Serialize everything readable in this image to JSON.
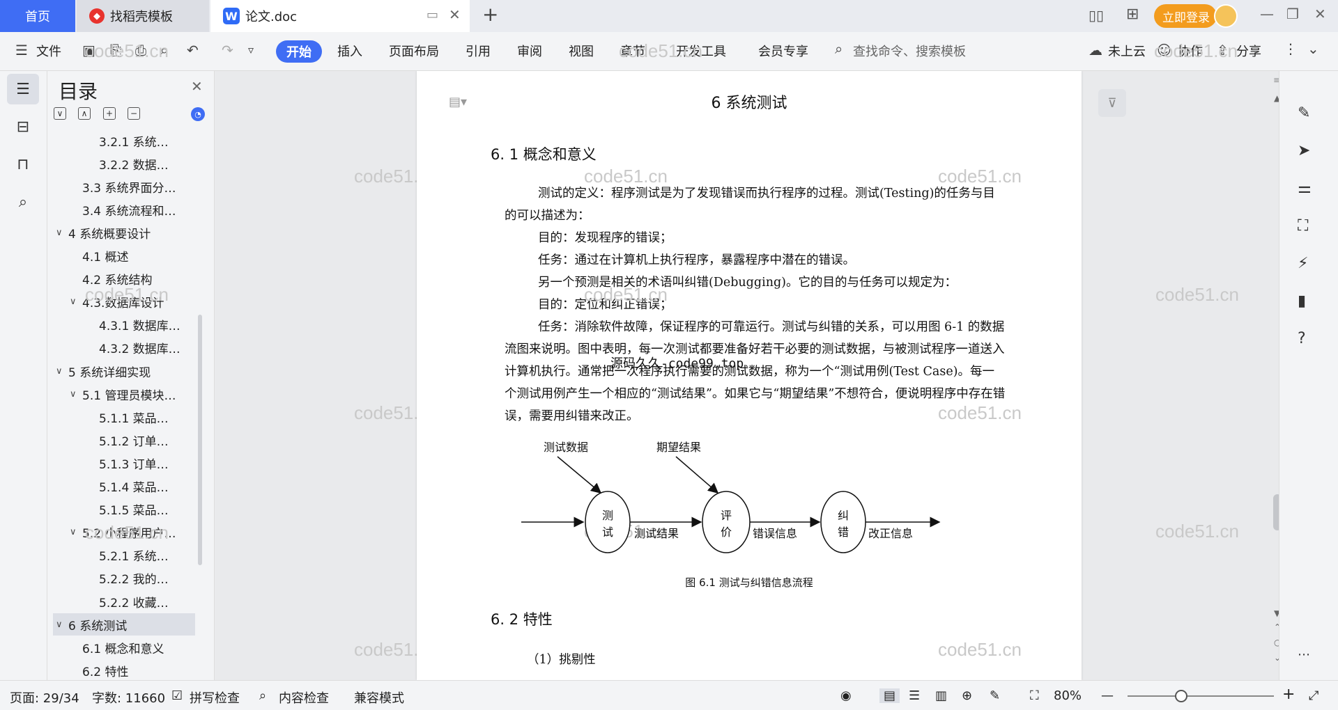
{
  "tabs": {
    "home": "首页",
    "daoke": "找稻壳模板",
    "doc": "论文.doc",
    "new_tab": "+"
  },
  "header": {
    "login": "立即登录"
  },
  "ribbon": {
    "file": "文件",
    "start": "开始",
    "insert": "插入",
    "layout": "页面布局",
    "reference": "引用",
    "review": "审阅",
    "view": "视图",
    "chapter": "章节",
    "devtools": "开发工具",
    "member": "会员专享",
    "search": "查找命令、搜索模板",
    "cloud": "未上云",
    "collab": "协作",
    "share": "分享"
  },
  "toc": {
    "title": "目录",
    "items": [
      {
        "label": "3.2.1 系统…",
        "level": 3
      },
      {
        "label": "3.2.2 数据…",
        "level": 3
      },
      {
        "label": "3.3 系统界面分…",
        "level": 2
      },
      {
        "label": "3.4 系统流程和…",
        "level": 2
      },
      {
        "label": "4 系统概要设计",
        "level": 1,
        "caret": "∨"
      },
      {
        "label": "4.1 概述",
        "level": 2
      },
      {
        "label": "4.2 系统结构",
        "level": 2
      },
      {
        "label": "4.3.数据库设计",
        "level": 2,
        "caret": "∨"
      },
      {
        "label": "4.3.1 数据库…",
        "level": 3
      },
      {
        "label": "4.3.2 数据库…",
        "level": 3
      },
      {
        "label": "5 系统详细实现",
        "level": 1,
        "caret": "∨"
      },
      {
        "label": "5.1 管理员模块…",
        "level": 2,
        "caret": "∨"
      },
      {
        "label": "5.1.1 菜品…",
        "level": 3
      },
      {
        "label": "5.1.2 订单…",
        "level": 3
      },
      {
        "label": "5.1.3 订单…",
        "level": 3
      },
      {
        "label": "5.1.4 菜品…",
        "level": 3
      },
      {
        "label": "5.1.5 菜品…",
        "level": 3
      },
      {
        "label": "5.2 小程序用户…",
        "level": 2,
        "caret": "∨"
      },
      {
        "label": "5.2.1 系统…",
        "level": 3
      },
      {
        "label": "5.2.2 我的…",
        "level": 3
      },
      {
        "label": "5.2.2 收藏…",
        "level": 3
      },
      {
        "label": "6 系统测试",
        "level": 1,
        "caret": "∨",
        "selected": true
      },
      {
        "label": "6.1 概念和意义",
        "level": 2
      },
      {
        "label": "6.2 特性",
        "level": 2
      }
    ]
  },
  "doc": {
    "chapter_title": "6 系统测试",
    "sec1_title": "6. 1 概念和意义",
    "paragraphs": [
      "测试的定义：程序测试是为了发现错误而执行程序的过程。测试(Testing)的任务与目的可以描述为：",
      "目的：发现程序的错误；",
      "任务：通过在计算机上执行程序，暴露程序中潜在的错误。",
      "另一个预测是相关的术语叫纠错(Debugging)。它的目的与任务可以规定为：",
      "目的：定位和纠正错误；",
      "任务：消除软件故障，保证程序的可靠运行。测试与纠错的关系，可以用图 6-1 的数据流图来说明。图中表明，每一次测试都要准备好若干必要的测试数据，与被测试程序一道送入计算机执行。通常把一次程序执行需要的测试数据，称为一个“测试用例(Test Case)。每一个测试用例产生一个相应的“测试结果”。如果它与“期望结果”不想符合，便说明程序中存在错误，需要用纠错来改正。"
    ],
    "overlay_watermark": "源码久久-code99.top",
    "diagram": {
      "test_data": "测试数据",
      "expected": "期望结果",
      "node_test": [
        "测",
        "试"
      ],
      "node_eval": [
        "评",
        "价"
      ],
      "node_fix": [
        "纠",
        "错"
      ],
      "test_result": "测试结果",
      "error_info": "错误信息",
      "fix_info": "改正信息",
      "caption": "图 6.1 测试与纠错信息流程"
    },
    "sec2_title": "6. 2 特性",
    "item1": "（1）挑剔性"
  },
  "watermark": "code51.cn",
  "status": {
    "page": "页面: 29/34",
    "words": "字数: 11660",
    "spell": "拼写检查",
    "content_check": "内容检查",
    "compat": "兼容模式",
    "zoom": "80%"
  }
}
